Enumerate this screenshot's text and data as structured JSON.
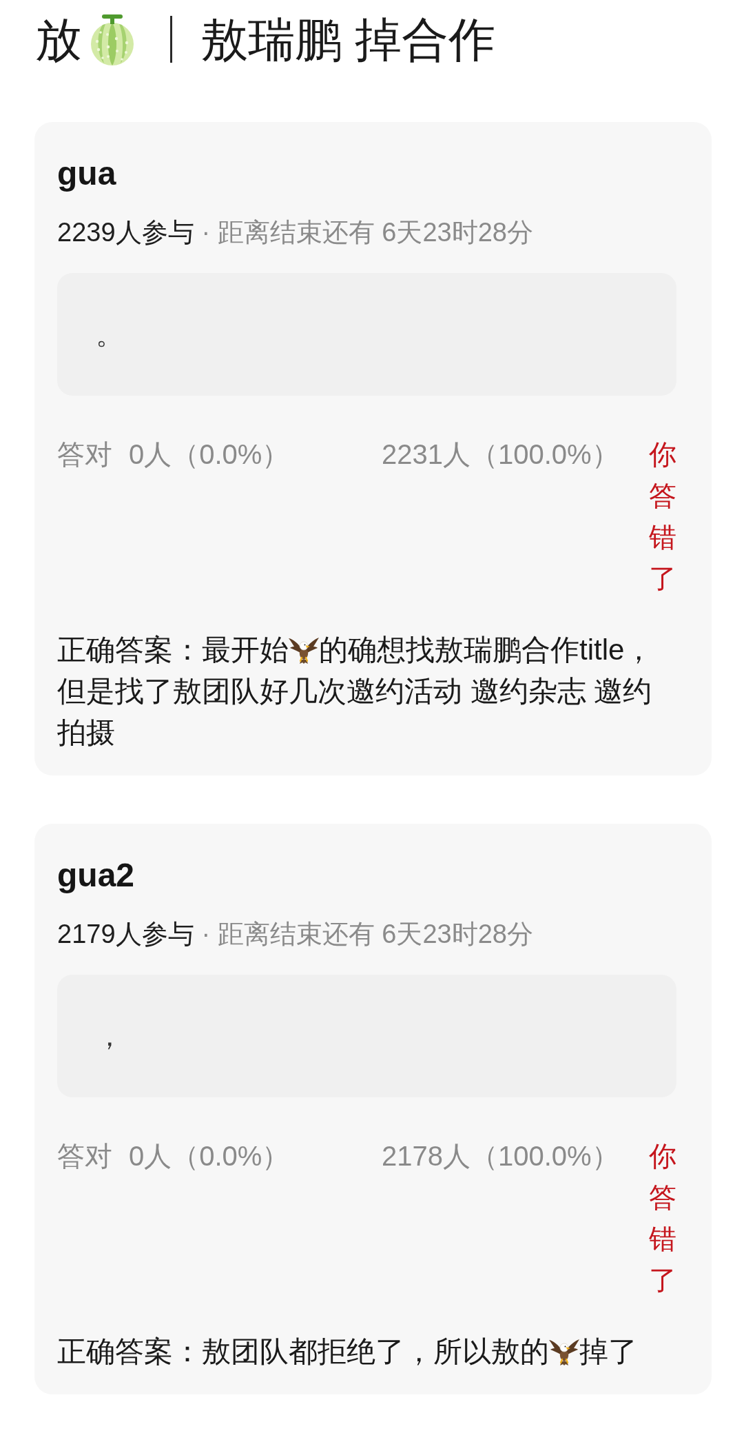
{
  "header": {
    "prefix": "放",
    "title": "敖瑞鹏 掉合作"
  },
  "quizzes": [
    {
      "title": "gua",
      "participants": "2239人参与",
      "countdown": "· 距离结束还有 6天23时28分",
      "answer": "。",
      "correct_label": "答对",
      "correct_count": "0人（0.0%）",
      "wrong_count": "2231人（100.0%）",
      "verdict": "你答错了",
      "explanation_lines": [
        [
          {
            "kind": "text",
            "text": "正确答案：最开始"
          },
          {
            "kind": "icon"
          },
          {
            "kind": "text",
            "text": "的确想找敖瑞鹏合作title，"
          }
        ],
        [
          {
            "kind": "text",
            "text": "但是找了敖团队好几次邀约活动 邀约杂志 邀约"
          }
        ],
        [
          {
            "kind": "text",
            "text": "拍摄"
          }
        ]
      ]
    },
    {
      "title": "gua2",
      "participants": "2179人参与",
      "countdown": "· 距离结束还有 6天23时28分",
      "answer": "，",
      "correct_label": "答对",
      "correct_count": "0人（0.0%）",
      "wrong_count": "2178人（100.0%）",
      "verdict": "你答错了",
      "explanation_lines": [
        [
          {
            "kind": "text",
            "text": "正确答案：敖团队都拒绝了，所以敖的"
          },
          {
            "kind": "icon"
          },
          {
            "kind": "text",
            "text": "掉了"
          }
        ]
      ]
    }
  ]
}
